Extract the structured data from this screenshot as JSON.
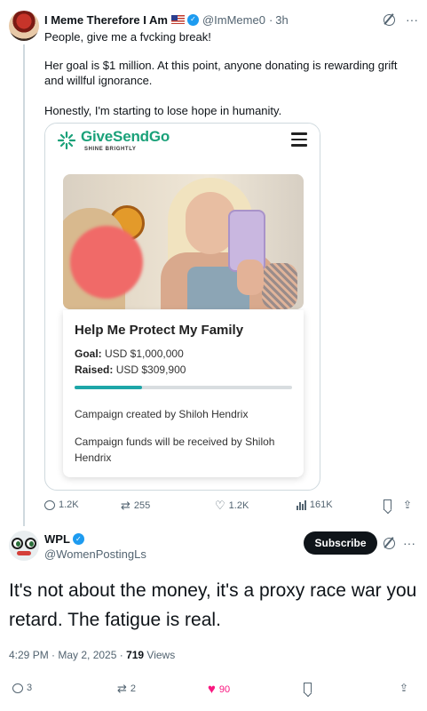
{
  "tweet1": {
    "author_name": "I Meme Therefore I Am",
    "handle": "@ImMeme0",
    "time": "3h",
    "paragraphs": [
      "People, give me a fvcking break!",
      "Her goal is $1 million. At this point, anyone donating is rewarding grift and willful ignorance.",
      "Honestly, I'm starting to lose hope in humanity."
    ],
    "embed": {
      "brand": "GiveSendGo",
      "tagline": "SHINE BRIGHTLY",
      "campaign_title": "Help Me Protect My Family",
      "goal_label": "Goal:",
      "goal_value": "USD $1,000,000",
      "raised_label": "Raised:",
      "raised_value": "USD $309,900",
      "progress_fraction": 0.31,
      "created_by": "Campaign created by Shiloh Hendrix",
      "received_by": "Campaign funds will be received by Shiloh Hendrix"
    },
    "stats": {
      "replies": "1.2K",
      "reposts": "255",
      "likes": "1.2K",
      "views": "161K"
    }
  },
  "tweet2": {
    "author_name": "WPL",
    "handle": "@WomenPostingLs",
    "subscribe_label": "Subscribe",
    "body": "It's not about the money, it's a proxy race war you retard. The fatigue is real.",
    "timestamp": "4:29 PM · May 2, 2025 · ",
    "views_count": "719",
    "views_label": " Views",
    "stats": {
      "replies": "3",
      "reposts": "2",
      "likes": "90"
    }
  },
  "colors": {
    "accent_blue": "#1d9bf0",
    "like_pink": "#f91880",
    "givesendgo_green": "#1aa179",
    "muted": "#536471"
  }
}
